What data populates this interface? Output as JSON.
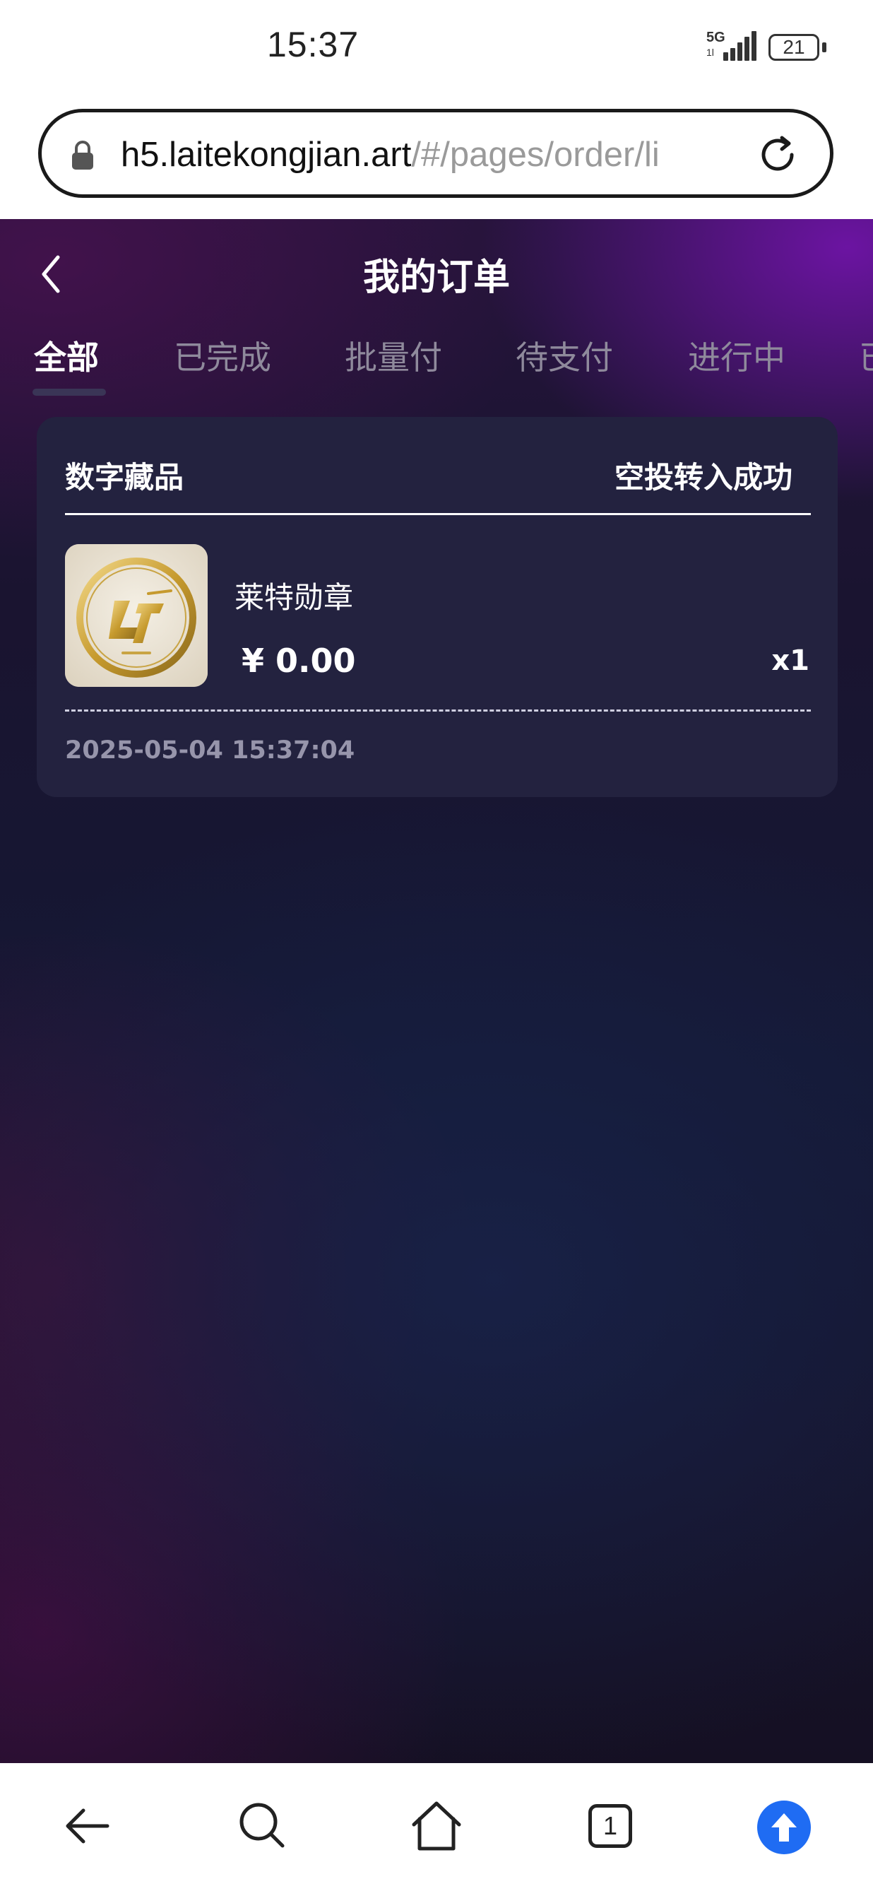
{
  "status_bar": {
    "time": "15:37",
    "network": "5G",
    "network_sub": "1l",
    "battery": "21"
  },
  "browser": {
    "url_host": "h5.laitekongjian.art",
    "url_path": "/#/pages/order/li",
    "tab_count": "1",
    "icons": [
      "lock-icon",
      "reload-icon",
      "back-arrow-icon",
      "search-icon",
      "home-icon",
      "tabs-icon",
      "upload-icon"
    ]
  },
  "page": {
    "title": "我的订单",
    "tabs": [
      {
        "label": "全部",
        "active": true
      },
      {
        "label": "已完成",
        "active": false
      },
      {
        "label": "批量付",
        "active": false
      },
      {
        "label": "待支付",
        "active": false
      },
      {
        "label": "进行中",
        "active": false
      },
      {
        "label": "已",
        "active": false
      }
    ]
  },
  "order": {
    "type": "数字藏品",
    "status": "空投转入成功",
    "product_name": "莱特勋章",
    "price": "¥ 0.00",
    "quantity": "x1",
    "time": "2025-05-04 15:37:04"
  },
  "colors": {
    "card_bg": "#23223f",
    "tab_inactive": "#8f8a9c",
    "upload_blue": "#1f6cf3"
  }
}
